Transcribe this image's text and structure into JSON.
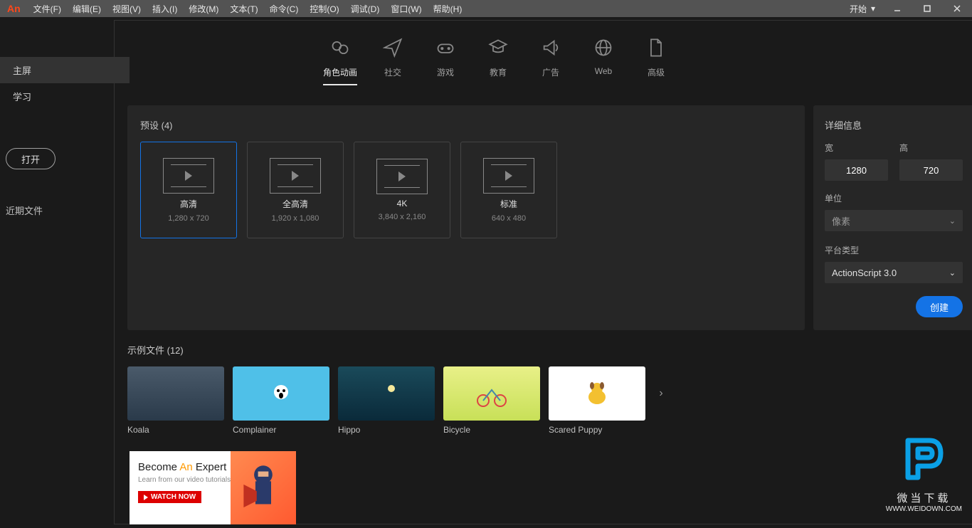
{
  "menubar": {
    "logo": "An",
    "items": [
      "文件(F)",
      "编辑(E)",
      "视图(V)",
      "插入(I)",
      "修改(M)",
      "文本(T)",
      "命令(C)",
      "控制(O)",
      "调试(D)",
      "窗口(W)",
      "帮助(H)"
    ],
    "start": "开始"
  },
  "sidebar": {
    "home": "主屏",
    "learn": "学习",
    "open": "打开",
    "recent": "近期文件"
  },
  "categories": [
    {
      "label": "角色动画"
    },
    {
      "label": "社交"
    },
    {
      "label": "游戏"
    },
    {
      "label": "教育"
    },
    {
      "label": "广告"
    },
    {
      "label": "Web"
    },
    {
      "label": "高级"
    }
  ],
  "presets": {
    "title": "预设 (4)",
    "items": [
      {
        "name": "高清",
        "dim": "1,280 x 720"
      },
      {
        "name": "全高清",
        "dim": "1,920 x 1,080"
      },
      {
        "name": "4K",
        "dim": "3,840 x 2,160"
      },
      {
        "name": "标准",
        "dim": "640 x 480"
      }
    ]
  },
  "details": {
    "title": "详细信息",
    "width_label": "宽",
    "height_label": "高",
    "width": "1280",
    "height": "720",
    "unit_label": "单位",
    "unit_value": "像素",
    "platform_label": "平台类型",
    "platform_value": "ActionScript 3.0",
    "create": "创建"
  },
  "samples": {
    "title": "示例文件 (12)",
    "items": [
      {
        "name": "Koala"
      },
      {
        "name": "Complainer"
      },
      {
        "name": "Hippo"
      },
      {
        "name": "Bicycle"
      },
      {
        "name": "Scared Puppy"
      }
    ]
  },
  "banner": {
    "title_pre": "Become ",
    "title_an": "An",
    "title_post": " Expert",
    "sub": "Learn from our video tutorials",
    "watch": "WATCH NOW"
  },
  "watermark": {
    "cn": "微当下载",
    "url": "WWW.WEIDOWN.COM"
  }
}
